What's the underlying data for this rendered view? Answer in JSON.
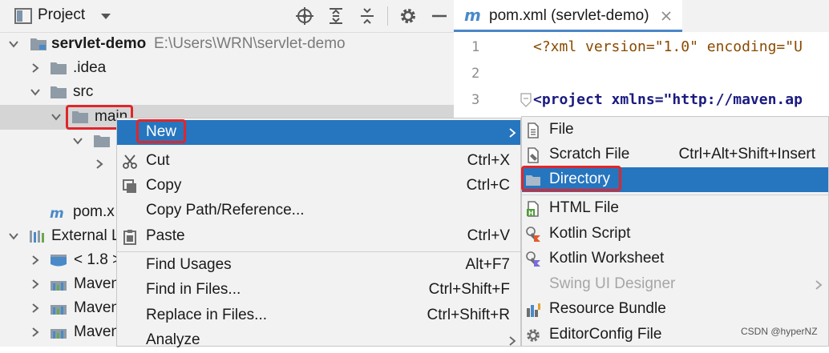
{
  "project_panel": {
    "title": "Project",
    "tree": [
      {
        "label": "servlet-demo",
        "path": "E:\\Users\\WRN\\servlet-demo"
      },
      {
        "label": ".idea"
      },
      {
        "label": "src"
      },
      {
        "label": "main"
      },
      {
        "label": ""
      },
      {
        "label": ""
      },
      {
        "label": "pom.x"
      },
      {
        "label": "External L"
      },
      {
        "label": "< 1.8 >"
      },
      {
        "label": "Maven"
      },
      {
        "label": "Maven"
      },
      {
        "label": "Maven"
      }
    ]
  },
  "editor": {
    "tab_label": "pom.xml (servlet-demo)",
    "lines": [
      {
        "num": "1",
        "text": "<?xml version=\"1.0\" encoding=\"U"
      },
      {
        "num": "2",
        "text": ""
      },
      {
        "num": "3",
        "text": "<project xmlns=\"http://maven.ap"
      }
    ]
  },
  "context_menu": {
    "items": [
      {
        "label": "New",
        "shortcut": ""
      },
      {
        "label": "Cut",
        "shortcut": "Ctrl+X"
      },
      {
        "label": "Copy",
        "shortcut": "Ctrl+C"
      },
      {
        "label": "Copy Path/Reference...",
        "shortcut": ""
      },
      {
        "label": "Paste",
        "shortcut": "Ctrl+V"
      },
      {
        "label": "Find Usages",
        "shortcut": "Alt+F7"
      },
      {
        "label": "Find in Files...",
        "shortcut": "Ctrl+Shift+F"
      },
      {
        "label": "Replace in Files...",
        "shortcut": "Ctrl+Shift+R"
      },
      {
        "label": "Analyze",
        "shortcut": ""
      }
    ]
  },
  "submenu": {
    "items": [
      {
        "label": "File",
        "shortcut": ""
      },
      {
        "label": "Scratch File",
        "shortcut": "Ctrl+Alt+Shift+Insert"
      },
      {
        "label": "Directory",
        "shortcut": ""
      },
      {
        "label": "HTML File",
        "shortcut": ""
      },
      {
        "label": "Kotlin Script",
        "shortcut": ""
      },
      {
        "label": "Kotlin Worksheet",
        "shortcut": ""
      },
      {
        "label": "Swing UI Designer",
        "shortcut": ""
      },
      {
        "label": "Resource Bundle",
        "shortcut": ""
      },
      {
        "label": "EditorConfig File",
        "shortcut": ""
      }
    ]
  },
  "watermark": "CSDN @hyperNZ",
  "colors": {
    "highlight": "#2675bf",
    "annotation": "#e0262a",
    "background": "#f2f2f2"
  }
}
